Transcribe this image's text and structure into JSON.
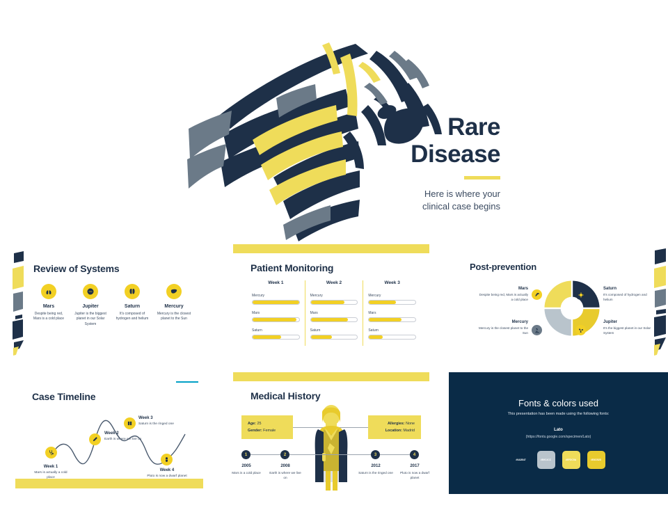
{
  "palette": {
    "navy": "#0a2b47",
    "navy_text": "#1e3048",
    "yellow": "#efdc5a",
    "gold": "#f2d024",
    "gray": "#b9c4cc",
    "teal": "#00a0c6",
    "slate": "#6b7a88"
  },
  "hero": {
    "title_line1": "Rare",
    "title_line2": "Disease",
    "subtitle_line1": "Here is where your",
    "subtitle_line2": "clinical case begins",
    "artwork": "zebra-illustration"
  },
  "review_of_systems": {
    "title": "Review of Systems",
    "items": [
      {
        "icon": "lungs-icon",
        "name": "Mars",
        "desc": "Despite being red, Mars is a cold place"
      },
      {
        "icon": "brain-icon",
        "name": "Jupiter",
        "desc": "Jupiter is the biggest planet in our Solar System"
      },
      {
        "icon": "kidneys-icon",
        "name": "Saturn",
        "desc": "It's composed of hydrogen and helium"
      },
      {
        "icon": "liver-icon",
        "name": "Mercury",
        "desc": "Mercury is the closest planet to the Sun"
      }
    ]
  },
  "patient_monitoring": {
    "title": "Patient Monitoring",
    "columns": [
      {
        "week": "Week 1",
        "metrics": [
          {
            "label": "Mercury",
            "value": 100
          },
          {
            "label": "Mars",
            "value": 95
          },
          {
            "label": "Saturn",
            "value": 62
          }
        ]
      },
      {
        "week": "Week 2",
        "metrics": [
          {
            "label": "Mercury",
            "value": 72
          },
          {
            "label": "Mars",
            "value": 80
          },
          {
            "label": "Saturn",
            "value": 45
          }
        ]
      },
      {
        "week": "Week 3",
        "metrics": [
          {
            "label": "Mercury",
            "value": 58
          },
          {
            "label": "Mars",
            "value": 70
          },
          {
            "label": "Saturn",
            "value": 30
          }
        ]
      }
    ]
  },
  "post_prevention": {
    "title": "Post-prevention",
    "items": [
      {
        "name": "Mars",
        "desc": "Despite being red, Mars is actually a cold place",
        "color": "#efdc5a",
        "icon": "syringe-icon",
        "side": "left-top"
      },
      {
        "name": "Saturn",
        "desc": "It's composed of hydrogen and helium",
        "color": "#1e3048",
        "icon": "virus-icon",
        "side": "right-top"
      },
      {
        "name": "Mercury",
        "desc": "Mercury is the closest planet to the Sun",
        "color": "#b9c4cc",
        "icon": "microscope-icon",
        "side": "left-bottom"
      },
      {
        "name": "Jupiter",
        "desc": "It's the biggest planet in our Solar System",
        "color": "#e8cb2d",
        "icon": "molecule-icon",
        "side": "right-bottom"
      }
    ]
  },
  "case_timeline": {
    "title": "Case Timeline",
    "nodes": [
      {
        "week": "Week 1",
        "desc": "Mars is actually a cold place",
        "icon": "stethoscope-icon"
      },
      {
        "week": "Week 2",
        "desc": "Earth is where we live on",
        "icon": "thermometer-icon"
      },
      {
        "week": "Week 3",
        "desc": "Saturn is the ringed one",
        "icon": "microscope-icon"
      },
      {
        "week": "Week 4",
        "desc": "Pluto is now a dwarf planet",
        "icon": "pill-icon"
      }
    ]
  },
  "medical_history": {
    "title": "Medical History",
    "figure": "patient-illustration",
    "left_box": [
      {
        "key": "Age:",
        "value": " 25"
      },
      {
        "key": "Gender:",
        "value": " Female"
      }
    ],
    "right_box": [
      {
        "key": "Allergies:",
        "value": " None"
      },
      {
        "key": "Location:",
        "value": " Madrid"
      }
    ],
    "milestones": [
      {
        "num": "1",
        "year": "2005",
        "desc": "Mars is a cold place"
      },
      {
        "num": "2",
        "year": "2008",
        "desc": "Earth is where we live on"
      },
      {
        "num": "3",
        "year": "2012",
        "desc": "Saturn is the ringed one"
      },
      {
        "num": "4",
        "year": "2017",
        "desc": "Pluto is now a dwarf planet"
      }
    ]
  },
  "fonts_colors": {
    "title": "Fonts & colors used",
    "subtitle": "This presentation has been made using the following fonts:",
    "font_name": "Lato",
    "font_url": "(https://fonts.google.com/specimen/Lato)",
    "swatches": [
      {
        "hex": "#0a2b47",
        "label": "#0A2B47",
        "text": "#ffffff"
      },
      {
        "hex": "#b9c4cc",
        "label": "#B9C4CC",
        "text": "#ffffff"
      },
      {
        "hex": "#efdc5a",
        "label": "#EFDC5A",
        "text": "#ffffff"
      },
      {
        "hex": "#e8cb2d",
        "label": "#E8CB2D",
        "text": "#ffffff"
      }
    ]
  }
}
